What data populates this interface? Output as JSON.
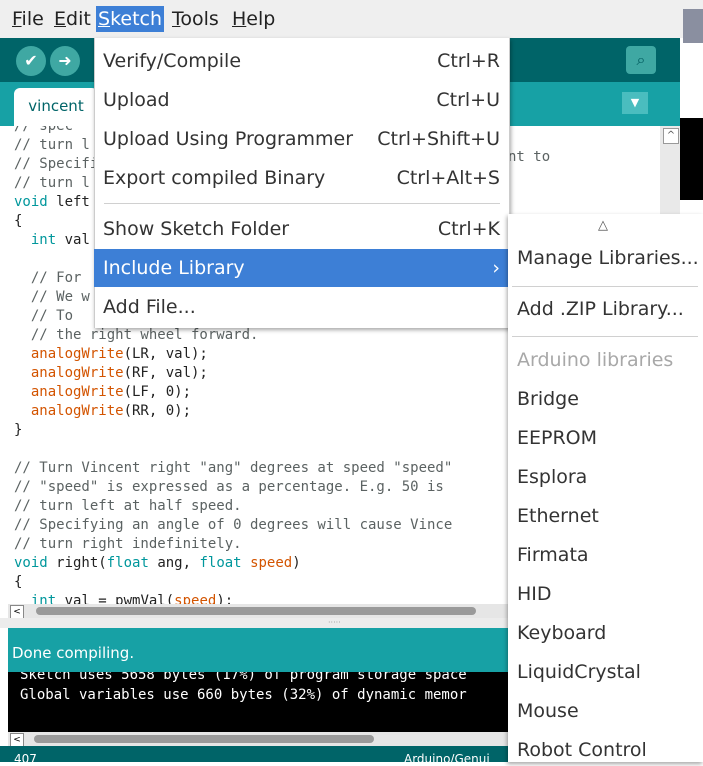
{
  "menubar": {
    "items": [
      {
        "label": "File",
        "key": "F",
        "rest": "ile"
      },
      {
        "label": "Edit",
        "key": "E",
        "rest": "dit"
      },
      {
        "label": "Sketch",
        "key": "S",
        "rest": "ketch"
      },
      {
        "label": "Tools",
        "key": "T",
        "rest": "ools"
      },
      {
        "label": "Help",
        "key": "H",
        "rest": "elp"
      }
    ]
  },
  "toolbar": {
    "verify_icon": "checkmark-icon",
    "upload_icon": "arrow-right-icon",
    "serial_monitor_icon": "magnifier-icon",
    "verify_glyph": "✔",
    "upload_glyph": "➜",
    "serial_glyph": "⌕"
  },
  "tabs": {
    "active": "vincent",
    "dropdown_glyph": "▼"
  },
  "editor": {
    "lines": [
      {
        "parts": [
          {
            "t": "// spec",
            "c": "cm"
          }
        ]
      },
      {
        "parts": [
          {
            "t": "// turn l",
            "c": "cm"
          }
        ]
      },
      {
        "parts": [
          {
            "t": "// Specifi",
            "c": "cm"
          }
        ]
      },
      {
        "parts": [
          {
            "t": "// turn l",
            "c": "cm"
          }
        ]
      },
      {
        "parts": [
          {
            "t": "void",
            "c": "kw"
          },
          {
            "t": " left",
            "c": ""
          }
        ]
      },
      {
        "parts": [
          {
            "t": "{",
            "c": ""
          }
        ]
      },
      {
        "parts": [
          {
            "t": "  ",
            "c": ""
          },
          {
            "t": "int",
            "c": "kw"
          },
          {
            "t": " val",
            "c": ""
          }
        ]
      },
      {
        "parts": [
          {
            "t": "",
            "c": ""
          }
        ]
      },
      {
        "parts": [
          {
            "t": "  // For",
            "c": "cm"
          }
        ]
      },
      {
        "parts": [
          {
            "t": "  // We w",
            "c": "cm"
          }
        ]
      },
      {
        "parts": [
          {
            "t": "  // To ",
            "c": "cm"
          }
        ]
      },
      {
        "parts": [
          {
            "t": "  // the right wheel forward.",
            "c": "cm"
          }
        ]
      },
      {
        "parts": [
          {
            "t": "  ",
            "c": ""
          },
          {
            "t": "analogWrite",
            "c": "fn"
          },
          {
            "t": "(LR, val);",
            "c": ""
          }
        ]
      },
      {
        "parts": [
          {
            "t": "  ",
            "c": ""
          },
          {
            "t": "analogWrite",
            "c": "fn"
          },
          {
            "t": "(RF, val);",
            "c": ""
          }
        ]
      },
      {
        "parts": [
          {
            "t": "  ",
            "c": ""
          },
          {
            "t": "analogWrite",
            "c": "fn"
          },
          {
            "t": "(LF, 0);",
            "c": ""
          }
        ]
      },
      {
        "parts": [
          {
            "t": "  ",
            "c": ""
          },
          {
            "t": "analogWrite",
            "c": "fn"
          },
          {
            "t": "(RR, 0);",
            "c": ""
          }
        ]
      },
      {
        "parts": [
          {
            "t": "}",
            "c": ""
          }
        ]
      },
      {
        "parts": [
          {
            "t": "",
            "c": ""
          }
        ]
      },
      {
        "parts": [
          {
            "t": "// Turn Vincent right \"ang\" degrees at speed \"speed\"",
            "c": "cm"
          }
        ]
      },
      {
        "parts": [
          {
            "t": "// \"speed\" is expressed as a percentage. E.g. 50 is",
            "c": "cm"
          }
        ]
      },
      {
        "parts": [
          {
            "t": "// turn left at half speed.",
            "c": "cm"
          }
        ]
      },
      {
        "parts": [
          {
            "t": "// Specifying an angle of 0 degrees will cause Vince",
            "c": "cm"
          }
        ]
      },
      {
        "parts": [
          {
            "t": "// turn right indefinitely.",
            "c": "cm"
          }
        ]
      },
      {
        "parts": [
          {
            "t": "void",
            "c": "kw"
          },
          {
            "t": " right(",
            "c": ""
          },
          {
            "t": "float",
            "c": "kw"
          },
          {
            "t": " ang, ",
            "c": ""
          },
          {
            "t": "float",
            "c": "kw"
          },
          {
            "t": " ",
            "c": ""
          },
          {
            "t": "speed",
            "c": "or"
          },
          {
            "t": ")",
            "c": ""
          }
        ]
      },
      {
        "parts": [
          {
            "t": "{",
            "c": ""
          }
        ]
      },
      {
        "parts": [
          {
            "t": "  ",
            "c": ""
          },
          {
            "t": "int",
            "c": "kw"
          },
          {
            "t": " val = pwmVal(",
            "c": ""
          },
          {
            "t": "speed",
            "c": "or"
          },
          {
            "t": ");",
            "c": ""
          }
        ]
      }
    ],
    "partial_right_text": "nt to"
  },
  "status": {
    "message": "Done compiling."
  },
  "console": {
    "lines": [
      "Sketch uses 5658 bytes (17%) of program storage space",
      "Global variables use 660 bytes (32%) of dynamic memor"
    ]
  },
  "bottombar": {
    "line_number": "407",
    "board": "Arduino/Genui"
  },
  "sketch_menu": {
    "items": [
      {
        "label": "Verify/Compile",
        "shortcut": "Ctrl+R"
      },
      {
        "label": "Upload",
        "shortcut": "Ctrl+U"
      },
      {
        "label": "Upload Using Programmer",
        "shortcut": "Ctrl+Shift+U"
      },
      {
        "label": "Export compiled Binary",
        "shortcut": "Ctrl+Alt+S"
      },
      {
        "label": "Show Sketch Folder",
        "shortcut": "Ctrl+K"
      },
      {
        "label": "Include Library",
        "shortcut": "›"
      },
      {
        "label": "Add File...",
        "shortcut": ""
      }
    ]
  },
  "include_library_menu": {
    "scroll_up_glyph": "△",
    "manage": "Manage Libraries...",
    "add_zip": "Add .ZIP Library...",
    "section_header": "Arduino libraries",
    "libraries": [
      "Bridge",
      "EEPROM",
      "Esplora",
      "Ethernet",
      "Firmata",
      "HID",
      "Keyboard",
      "LiquidCrystal",
      "Mouse",
      "Robot Control"
    ]
  },
  "scrollbars": {
    "up_glyph": "^",
    "left_glyph": "<",
    "splitter_glyph": "·····"
  }
}
